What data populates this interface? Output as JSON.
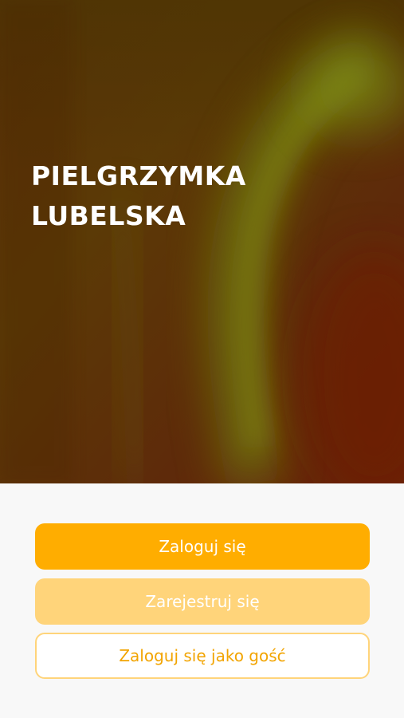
{
  "hero": {
    "title_line1": "PIELGRZYMKA",
    "title_line2": "LUBELSKA"
  },
  "actions": {
    "login_label": "Zaloguj się",
    "register_label": "Zarejestruj się",
    "guest_label": "Zaloguj się jako gość"
  },
  "colors": {
    "primary": "#ffad00",
    "primary_light": "#ffd47a",
    "guest_text": "#f2a400",
    "hero_dark": "#5e2a0c",
    "hero_glow": "#7c8a12",
    "background": "#f8f8f8"
  }
}
